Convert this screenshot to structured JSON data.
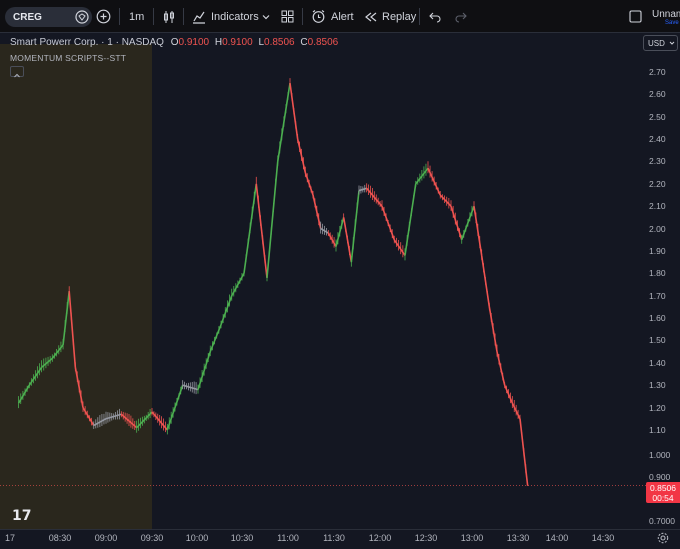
{
  "toolbar": {
    "symbol": "CREG",
    "interval": "1m",
    "indicators_label": "Indicators",
    "alert_label": "Alert",
    "replay_label": "Replay",
    "layout_name": "Unnam",
    "save_label": "Save"
  },
  "legend": {
    "title": "Smart Powerr Corp. · 1 · NASDAQ",
    "o_label": "O",
    "o_value": "0.9100",
    "h_label": "H",
    "h_value": "0.9100",
    "l_label": "L",
    "l_value": "0.8506",
    "c_label": "C",
    "c_value": "0.8506"
  },
  "study_name": "MOMENTUM SCRIPTS--STT",
  "currency": "USD",
  "price_axis": [
    "2.70",
    "2.60",
    "2.50",
    "2.40",
    "2.30",
    "2.20",
    "2.10",
    "2.00",
    "1.90",
    "1.80",
    "1.70",
    "1.60",
    "1.50",
    "1.40",
    "1.30",
    "1.20",
    "1.10",
    "1.000",
    "0.900",
    "0.7000"
  ],
  "last_price": {
    "price": "0.8506",
    "countdown": "00:54"
  },
  "time_axis": [
    "17",
    "08:30",
    "09:00",
    "09:30",
    "10:00",
    "10:30",
    "11:00",
    "11:30",
    "12:00",
    "12:30",
    "13:00",
    "13:30",
    "14:00",
    "14:30"
  ],
  "colors": {
    "up": "#4caf50",
    "down": "#ef5350",
    "neutral": "#9598a1",
    "premarket_bg": "#2a271d",
    "background": "#141722"
  },
  "chart_data": {
    "type": "line",
    "x": [
      "08:03",
      "08:10",
      "08:18",
      "08:25",
      "08:32",
      "08:36",
      "08:40",
      "08:45",
      "08:52",
      "09:00",
      "09:10",
      "09:20",
      "09:30",
      "09:40",
      "09:50",
      "10:00",
      "10:08",
      "10:15",
      "10:22",
      "10:30",
      "10:38",
      "10:45",
      "10:52",
      "11:00",
      "11:05",
      "11:10",
      "11:15",
      "11:20",
      "11:25",
      "11:30",
      "11:35",
      "11:40",
      "11:45",
      "11:50",
      "12:00",
      "12:08",
      "12:15",
      "12:22",
      "12:30",
      "12:38",
      "12:45",
      "12:52",
      "13:00",
      "13:05",
      "13:10",
      "13:15",
      "13:20",
      "13:25",
      "13:30",
      "13:35"
    ],
    "y": [
      1.22,
      1.3,
      1.38,
      1.42,
      1.48,
      1.72,
      1.38,
      1.2,
      1.12,
      1.15,
      1.17,
      1.11,
      1.18,
      1.1,
      1.3,
      1.28,
      1.45,
      1.57,
      1.7,
      1.8,
      2.2,
      1.78,
      2.3,
      2.65,
      2.4,
      2.25,
      2.15,
      2.0,
      1.98,
      1.92,
      2.05,
      1.85,
      2.17,
      2.18,
      2.1,
      1.95,
      1.88,
      2.2,
      2.27,
      2.15,
      2.1,
      1.95,
      2.1,
      1.88,
      1.65,
      1.45,
      1.3,
      1.22,
      1.15,
      0.85
    ],
    "ylim": [
      0.7,
      2.75
    ]
  }
}
